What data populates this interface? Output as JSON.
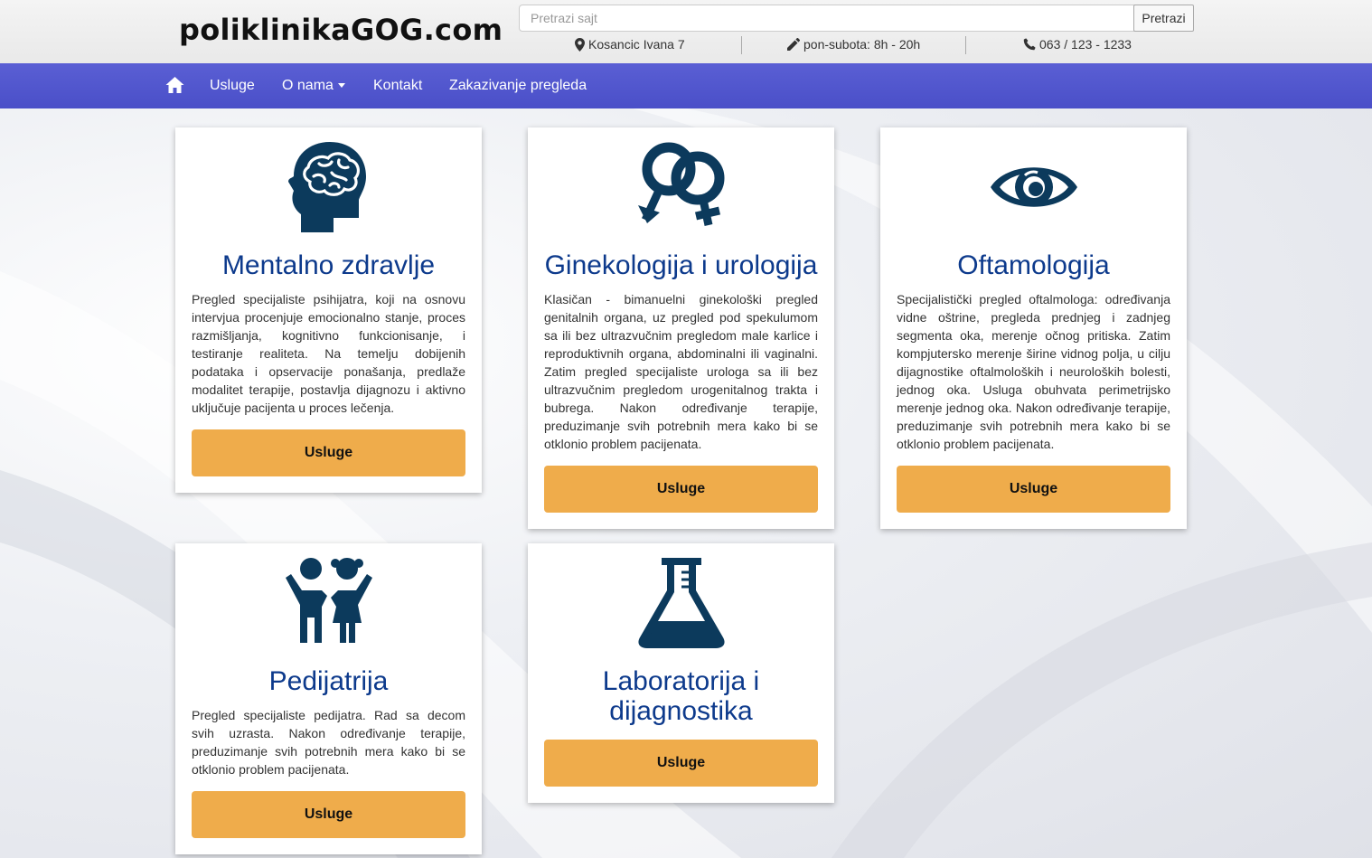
{
  "header": {
    "logo": "poliklinikaGOG.com",
    "search_placeholder": "Pretrazi sajt",
    "search_button": "Pretrazi",
    "address": "Kosancic Ivana 7",
    "hours": "pon-subota: 8h - 20h",
    "phone": "063 / 123 - 1233"
  },
  "nav": {
    "items": [
      "Usluge",
      "O nama",
      "Kontakt",
      "Zakazivanje pregleda"
    ]
  },
  "cards": [
    {
      "title": "Mentalno zdravlje",
      "icon": "brain-head-icon",
      "text": "Pregled specijaliste psihijatra, koji na osnovu intervjua procenjuje emocionalno stanje, proces razmišljanja, kognitivno funkcionisanje, i testiranje realiteta. Na temelju dobijenih podataka i opservacije ponašanja, predlaže modalitet terapije, postavlja dijagnozu i aktivno uključuje pacijenta u proces lečenja.",
      "button": "Usluge"
    },
    {
      "title": "Ginekologija i urologija",
      "icon": "gender-symbols-icon",
      "text": "Klasičan - bimanuelni ginekološki pregled genitalnih organa, uz pregled pod spekulumom sa ili bez ultrazvučnim pregledom male karlice i reproduktivnih organa, abdominalni ili vaginalni. Zatim pregled specijaliste urologa sa ili bez ultrazvučnim pregledom urogenitalnog trakta i bubrega. Nakon određivanje terapije, preduzimanje svih potrebnih mera kako bi se otklonio problem pacijenata.",
      "button": "Usluge"
    },
    {
      "title": "Oftamologija",
      "icon": "eye-icon",
      "text": "Specijalistički pregled oftalmologa: određivanja vidne oštrine, pregleda prednjeg i zadnjeg segmenta oka, merenje očnog pritiska. Zatim kompjutersko merenje širine vidnog polja, u cilju dijagnostike oftalmoloških i neuroloških bolesti, jednog oka. Usluga obuhvata perimetrijsko merenje jednog oka. Nakon određivanje terapije, preduzimanje svih potrebnih mera kako bi se otklonio problem pacijenata.",
      "button": "Usluge"
    },
    {
      "title": "Pedijatrija",
      "icon": "children-icon",
      "text": "Pregled specijaliste pedijatra. Rad sa decom svih uzrasta. Nakon određivanje terapije, preduzimanje svih potrebnih mera kako bi se otklonio problem pacijenata.",
      "button": "Usluge"
    },
    {
      "title": "Laboratorija i dijagnostika",
      "icon": "flask-icon",
      "text": "",
      "button": "Usluge"
    }
  ],
  "colors": {
    "nav": "#4f54cc",
    "title": "#0d3a8c",
    "icon": "#0c3a5c",
    "button": "#efac4b"
  }
}
